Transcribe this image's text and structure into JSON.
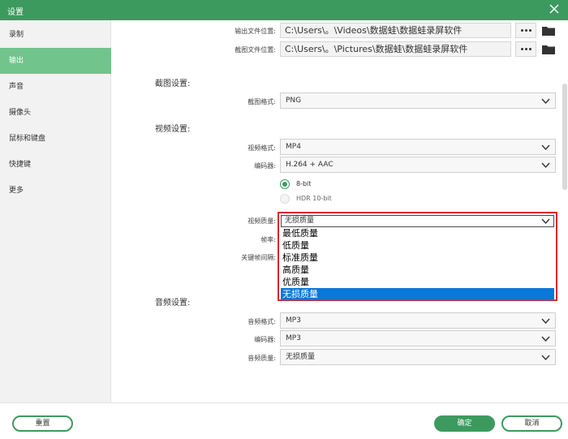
{
  "window": {
    "title": "设置"
  },
  "sidebar": {
    "items": [
      {
        "label": "录制"
      },
      {
        "label": "输出"
      },
      {
        "label": "声音"
      },
      {
        "label": "摄像头"
      },
      {
        "label": "鼠标和键盘"
      },
      {
        "label": "快捷键"
      },
      {
        "label": "更多"
      }
    ],
    "active": "输出"
  },
  "paths": {
    "output_label": "输出文件位置:",
    "output_value": "C:\\Users\\。\\Videos\\数据蛙\\数据蛙录屏软件",
    "screenshot_label": "截图文件位置:",
    "screenshot_value": "C:\\Users\\。\\Pictures\\数据蛙\\数据蛙录屏软件"
  },
  "screenshot_settings": {
    "section": "截图设置:",
    "format_label": "截图格式:",
    "format_value": "PNG"
  },
  "video_settings": {
    "section": "视频设置:",
    "format_label": "视频格式:",
    "format_value": "MP4",
    "encoder_label": "编码器:",
    "encoder_value": "H.264 + AAC",
    "bit_8": "8-bit",
    "bit_hdr": "HDR 10-bit",
    "quality_label": "视频质量:",
    "quality_value": "无损质量",
    "framerate_label": "帧率:",
    "keyframe_label": "关键帧间隔:",
    "quality_options": [
      "最低质量",
      "低质量",
      "标准质量",
      "高质量",
      "优质量",
      "无损质量"
    ],
    "quality_selected_index": 5
  },
  "audio_settings": {
    "section": "音频设置:",
    "format_label": "音频格式:",
    "format_value": "MP3",
    "encoder_label": "编码器:",
    "encoder_value": "MP3",
    "quality_label": "音频质量:",
    "quality_value": "无损质量"
  },
  "footer": {
    "reset_label": "重置",
    "ok_label": "确定",
    "cancel_label": "取消"
  },
  "colors": {
    "accent": "#3d9a5f",
    "sidebar_active": "#72c48d",
    "highlight_border": "#e0262b",
    "selection": "#0a78d7"
  }
}
